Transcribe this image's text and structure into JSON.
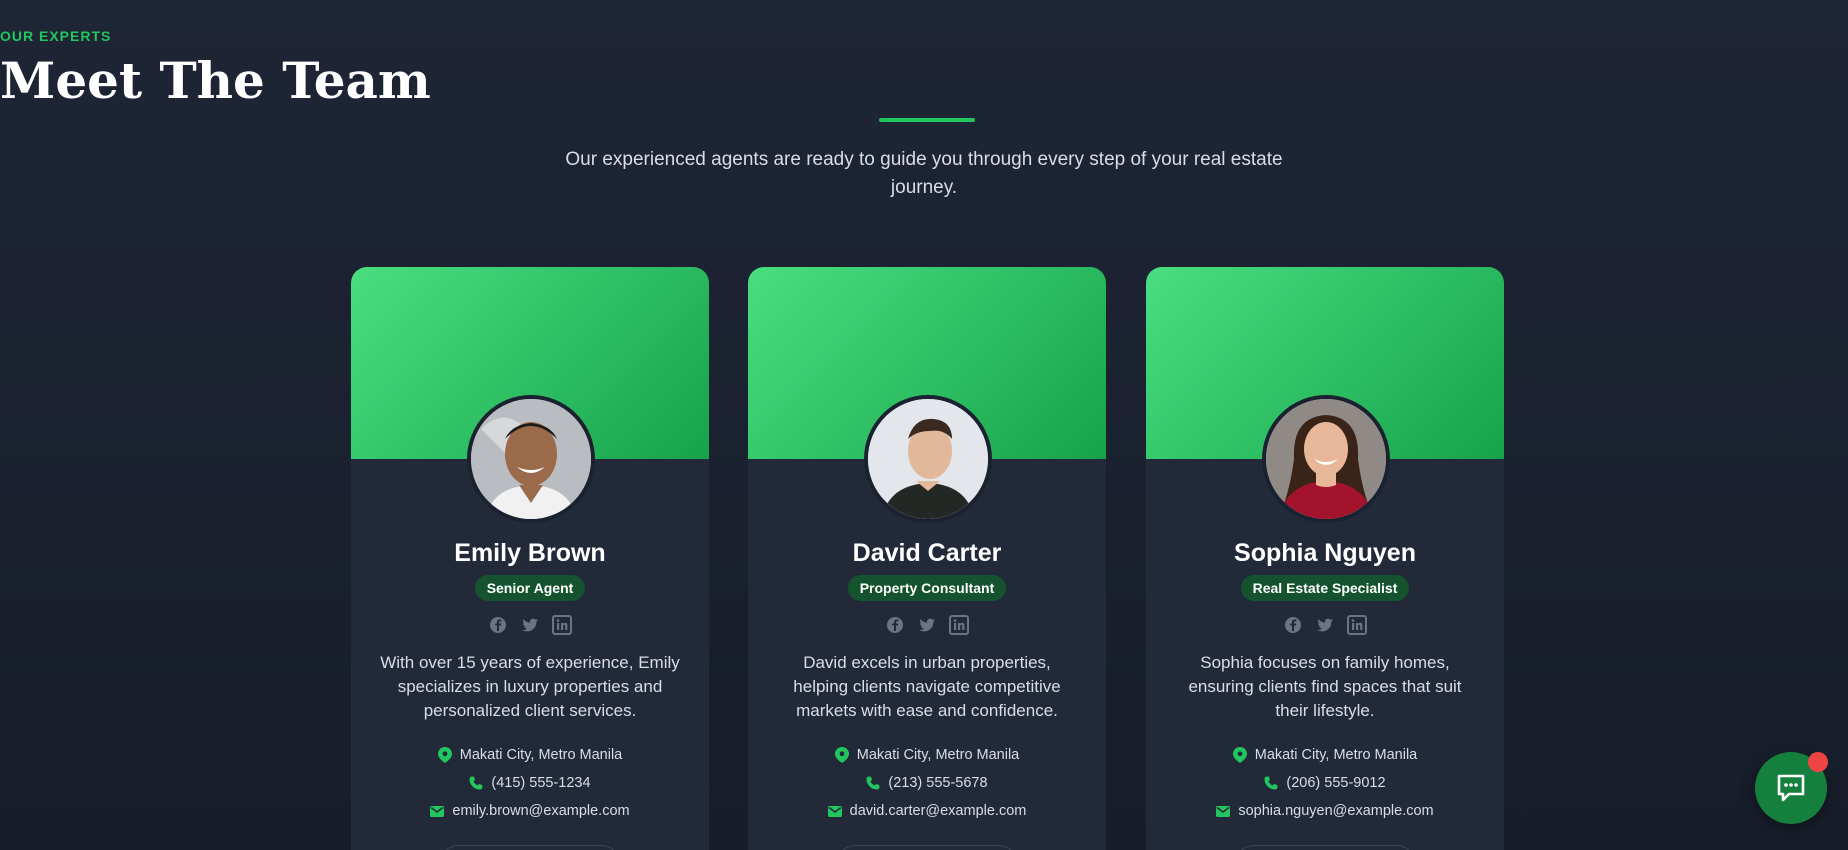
{
  "section": {
    "eyebrow": "OUR EXPERTS",
    "title": "Meet The Team",
    "subtitle": "Our experienced agents are ready to guide you through every step of your real estate journey."
  },
  "colors": {
    "accent": "#22c55e",
    "badge_bg": "#14532d",
    "card_bg": "#222a3a",
    "page_bg": "#1e2535",
    "notification": "#ef4444"
  },
  "agents": [
    {
      "name": "Emily Brown",
      "role": "Senior Agent",
      "bio": "With over 15 years of experience, Emily specializes in luxury properties and personalized client services.",
      "location": "Makati City, Metro Manila",
      "phone": "(415) 555-1234",
      "email": "emily.brown@example.com"
    },
    {
      "name": "David Carter",
      "role": "Property Consultant",
      "bio": "David excels in urban properties, helping clients navigate competitive markets with ease and confidence.",
      "location": "Makati City, Metro Manila",
      "phone": "(213) 555-5678",
      "email": "david.carter@example.com"
    },
    {
      "name": "Sophia Nguyen",
      "role": "Real Estate Specialist",
      "bio": "Sophia focuses on family homes, ensuring clients find spaces that suit their lifestyle.",
      "location": "Makati City, Metro Manila",
      "phone": "(206) 555-9012",
      "email": "sophia.nguyen@example.com"
    }
  ],
  "icons": {
    "social": [
      "facebook-icon",
      "twitter-icon",
      "linkedin-icon"
    ],
    "contact": [
      "map-pin-icon",
      "phone-icon",
      "mail-icon"
    ],
    "chat": "chat-icon"
  }
}
